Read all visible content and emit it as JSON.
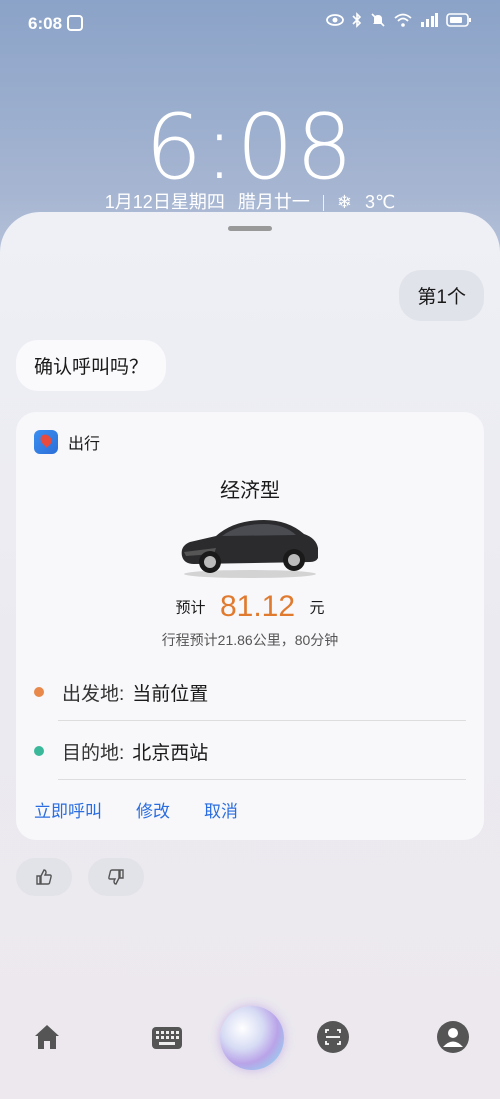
{
  "status_bar": {
    "time": "6:08",
    "icons": [
      "notification-icon",
      "eye-icon",
      "bluetooth-icon",
      "mute-icon",
      "wifi-icon",
      "signal-icon",
      "battery-icon"
    ]
  },
  "lockscreen": {
    "clock": "6:08",
    "date": "1月12日星期四",
    "lunar": "腊月廿一",
    "weather_icon": "snow-icon",
    "temperature": "3℃"
  },
  "conversation": {
    "user_message": "第1个",
    "assistant_message": "确认呼叫吗？"
  },
  "ride_card": {
    "app_name": "出行",
    "car_type": "经济型",
    "price_label": "预计",
    "price": "81.12",
    "price_unit": "元",
    "trip_info": "行程预计21.86公里，80分钟",
    "origin_label": "出发地:",
    "origin": "当前位置",
    "destination_label": "目的地:",
    "destination": "北京西站",
    "actions": {
      "call": "立即呼叫",
      "modify": "修改",
      "cancel": "取消"
    },
    "colors": {
      "price": "#e07a2f",
      "origin_dot": "#e8884a",
      "destination_dot": "#3bb89a",
      "action": "#2a6de0"
    }
  },
  "feedback": {
    "icons": [
      "thumbs-up-icon",
      "thumbs-down-icon"
    ]
  },
  "bottom_nav": {
    "icons": [
      "home-icon",
      "keyboard-icon",
      "voice-orb",
      "scan-icon",
      "profile-icon"
    ]
  }
}
